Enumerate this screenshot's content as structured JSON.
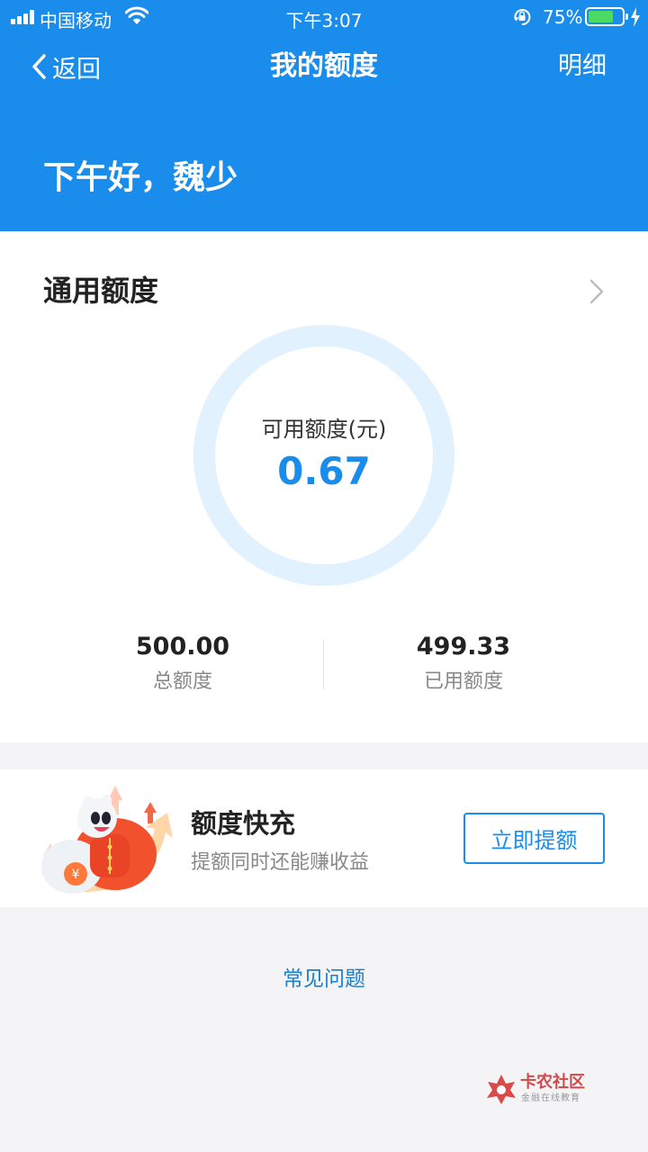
{
  "status_bar": {
    "carrier": "中国移动",
    "time": "下午3:07",
    "battery_percent": "75%",
    "battery_level": 0.75,
    "icons": [
      "signal-icon",
      "wifi-icon",
      "rotation-lock-icon",
      "battery-icon",
      "charging-icon"
    ]
  },
  "nav": {
    "back_label": "返回",
    "title": "我的额度",
    "detail_label": "明细"
  },
  "greeting": "下午好，魏少",
  "quota": {
    "title": "通用额度",
    "available_label": "可用额度(元)",
    "available_value": "0.67",
    "total_value": "500.00",
    "total_label": "总额度",
    "used_value": "499.33",
    "used_label": "已用额度"
  },
  "promo": {
    "title": "额度快充",
    "subtitle": "提额同时还能赚收益",
    "button_label": "立即提额",
    "mascot_symbol": "¥"
  },
  "faq_label": "常见问题",
  "watermark": {
    "name": "卡农社区",
    "tagline": "金融在线教育"
  },
  "colors": {
    "primary": "#1a8ceb",
    "ring": "#e1f1fd",
    "battery": "#4cd964",
    "background": "#f4f4f6"
  }
}
